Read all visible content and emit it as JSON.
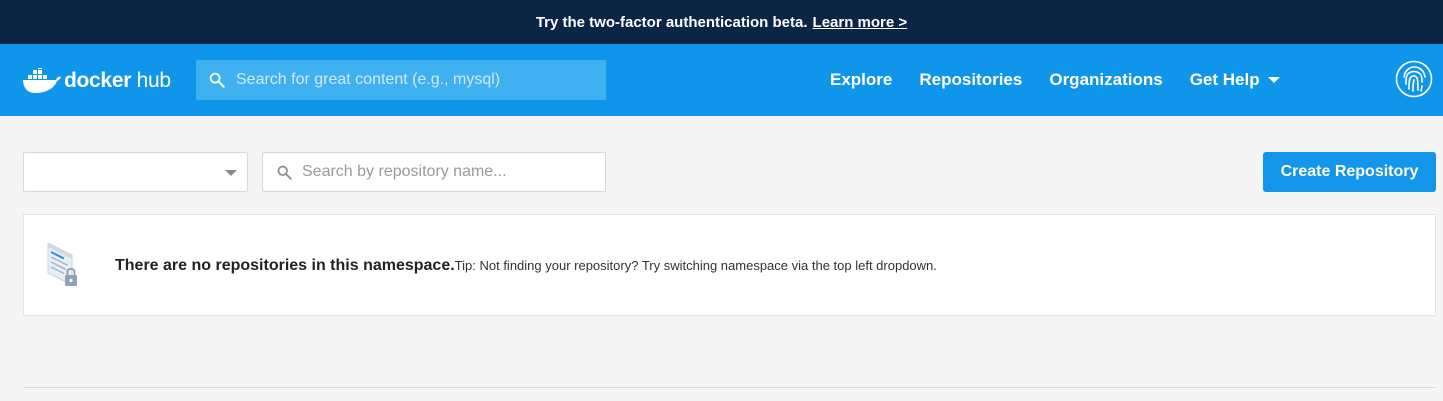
{
  "banner": {
    "text": "Try the two-factor authentication beta.",
    "link": "Learn more >"
  },
  "header": {
    "logo_word1": "docker",
    "logo_word2": "hub",
    "search_placeholder": "Search for great content (e.g., mysql)",
    "nav": [
      "Explore",
      "Repositories",
      "Organizations",
      "Get Help"
    ],
    "user_icon": "fingerprint-icon"
  },
  "toolbar": {
    "namespace_selected": "",
    "repo_search_placeholder": "Search by repository name...",
    "create_label": "Create Repository"
  },
  "empty_state": {
    "title": "There are no repositories in this namespace.",
    "tip": "Tip: Not finding your repository? Try switching namespace via the top left dropdown."
  },
  "colors": {
    "banner_bg": "#0b2545",
    "nav_bg": "#0f96ea",
    "button_bg": "#1396ea",
    "page_bg": "#f5f5f5"
  }
}
